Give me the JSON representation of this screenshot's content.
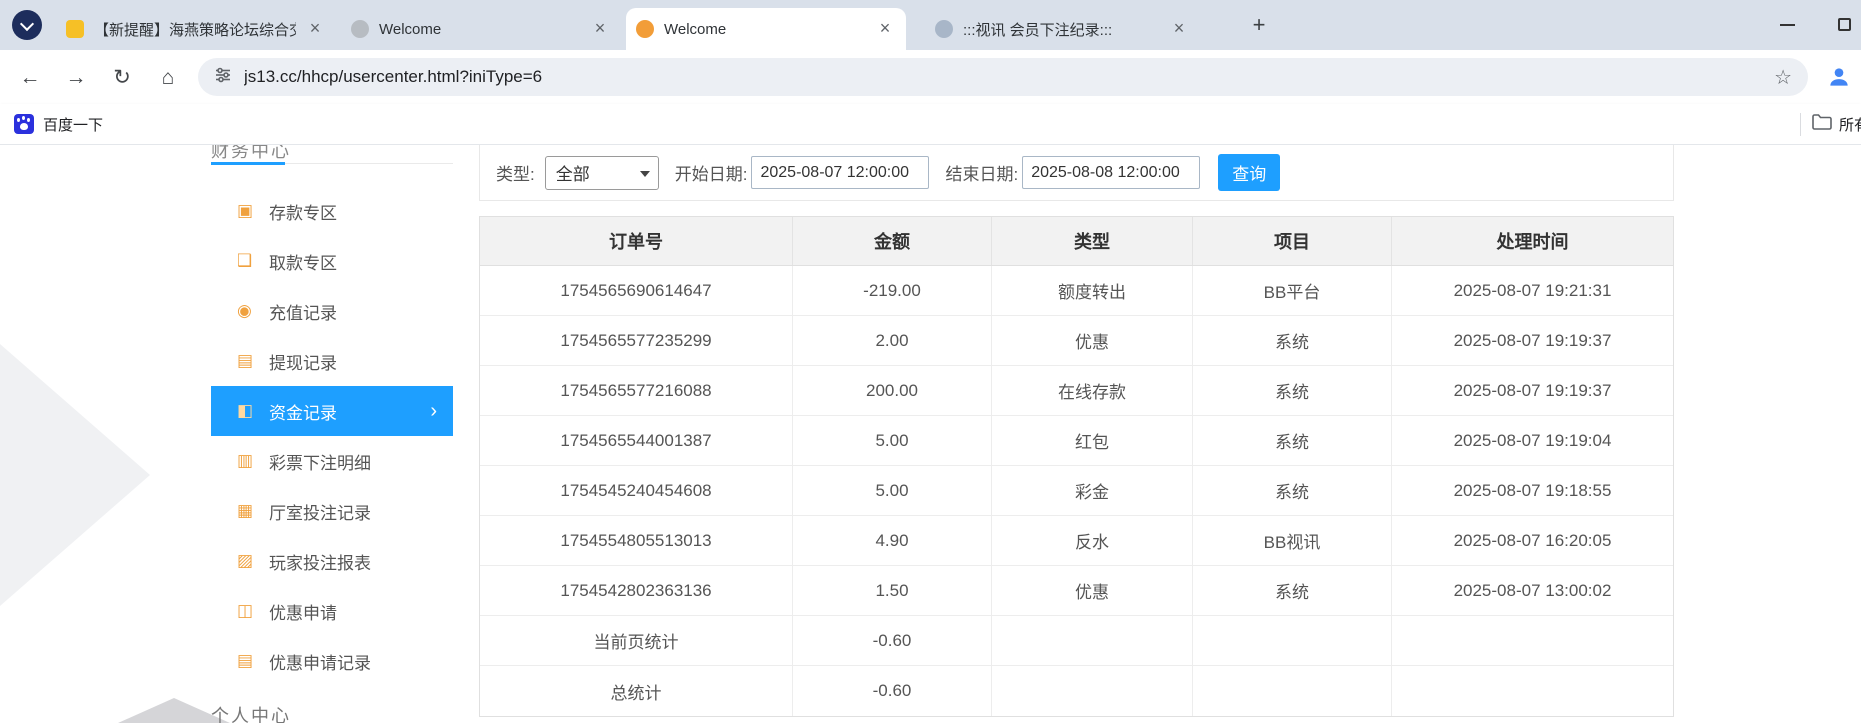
{
  "colors": {
    "accent": "#1e9fff",
    "icon-orange": "#f0a13e",
    "tabstrip": "#d9e0ea",
    "header-bg": "#f2f2f2"
  },
  "browser": {
    "tabs": [
      {
        "title": "【新提醒】海燕策略论坛综合交",
        "favicon": "#f6c026",
        "favicon_shape": "square",
        "active": false
      },
      {
        "title": "Welcome",
        "favicon": "#b7bcc2",
        "favicon_shape": "circle",
        "active": false
      },
      {
        "title": "Welcome",
        "favicon": "#f29d38",
        "favicon_shape": "circle",
        "active": true
      },
      {
        "title": ":::视讯 会员下注纪录:::",
        "favicon": "#a8b6c8",
        "favicon_shape": "circle",
        "active": false
      }
    ],
    "url": "js13.cc/hhcp/usercenter.html?iniType=6",
    "bookmarks_bar": {
      "bookmark_label": "百度一下",
      "all_bookmarks_label": "所有书签"
    }
  },
  "sidebar": {
    "finance_section": "财务中心",
    "personal_section": "个人中心",
    "items": [
      {
        "icon": "▣",
        "label": "存款专区",
        "arrow": "",
        "active": false
      },
      {
        "icon": "❑",
        "label": "取款专区",
        "arrow": "",
        "active": false
      },
      {
        "icon": "◉",
        "label": "充值记录",
        "arrow": "",
        "active": false
      },
      {
        "icon": "▤",
        "label": "提现记录",
        "arrow": "",
        "active": false
      },
      {
        "icon": "◧",
        "label": "资金记录",
        "arrow": "›",
        "active": true
      },
      {
        "icon": "▥",
        "label": "彩票下注明细",
        "arrow": "",
        "active": false
      },
      {
        "icon": "▦",
        "label": "厅室投注记录",
        "arrow": "",
        "active": false
      },
      {
        "icon": "▨",
        "label": "玩家投注报表",
        "arrow": "",
        "active": false
      },
      {
        "icon": "◫",
        "label": "优惠申请",
        "arrow": "",
        "active": false
      },
      {
        "icon": "▤",
        "label": "优惠申请记录",
        "arrow": "",
        "active": false
      }
    ]
  },
  "filters": {
    "type_label": "类型:",
    "type_value": "全部",
    "start_label": "开始日期:",
    "start_value": "2025-08-07 12:00:00",
    "end_label": "结束日期:",
    "end_value": "2025-08-08 12:00:00",
    "search_button": "查询"
  },
  "table": {
    "headers": [
      "订单号",
      "金额",
      "类型",
      "项目",
      "处理时间"
    ],
    "rows": [
      [
        "1754565690614647",
        "-219.00",
        "额度转出",
        "BB平台",
        "2025-08-07 19:21:31"
      ],
      [
        "1754565577235299",
        "2.00",
        "优惠",
        "系统",
        "2025-08-07 19:19:37"
      ],
      [
        "1754565577216088",
        "200.00",
        "在线存款",
        "系统",
        "2025-08-07 19:19:37"
      ],
      [
        "1754565544001387",
        "5.00",
        "红包",
        "系统",
        "2025-08-07 19:19:04"
      ],
      [
        "1754545240454608",
        "5.00",
        "彩金",
        "系统",
        "2025-08-07 19:18:55"
      ],
      [
        "1754554805513013",
        "4.90",
        "反水",
        "BB视讯",
        "2025-08-07 16:20:05"
      ],
      [
        "1754542802363136",
        "1.50",
        "优惠",
        "系统",
        "2025-08-07 13:00:02"
      ],
      [
        "当前页统计",
        "-0.60",
        "",
        "",
        ""
      ],
      [
        "总统计",
        "-0.60",
        "",
        "",
        ""
      ]
    ]
  }
}
